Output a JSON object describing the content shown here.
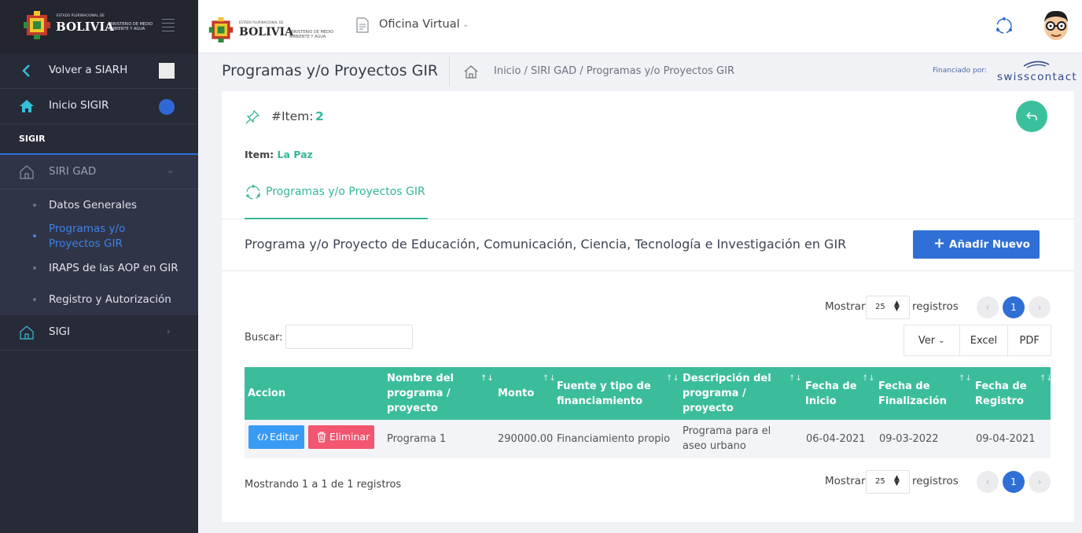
{
  "brand": {
    "emblem_small": "ESTADO PLURINACIONAL DE",
    "name": "BOLIVIA",
    "ministry": "MINISTERIO DE MEDIO AMBIENTE Y AGUA"
  },
  "sidebar": {
    "back": "Volver a SIARH",
    "home": "Inicio SIGIR",
    "section": "SIGIR",
    "group": "SIRI GAD",
    "items": [
      "Datos Generales",
      "Programas y/o Proyectos GIR",
      "IRAPS de las AOP en GIR",
      "Registro y Autorización"
    ],
    "other": "SIGI"
  },
  "topbar": {
    "office": "Oficina Virtual"
  },
  "header": {
    "title": "Programas y/o Proyectos GIR",
    "breadcrumb": "Inicio  /  SIRI GAD  /  Programas y/o Proyectos GIR",
    "funded_by": "Financiado por:",
    "sponsor": "swisscontact"
  },
  "card": {
    "item_label": "#Item:",
    "item_value": "2",
    "item2_label": "Item:",
    "item2_value": "La Paz",
    "tab": "Programas y/o Proyectos GIR",
    "section_title": "Programa y/o Proyecto de Educación, Comunicación, Ciencia, Tecnología e Investigación en GIR",
    "add_button": "Añadir Nuevo"
  },
  "table_controls": {
    "show": "Mostrar",
    "page_size": "25",
    "records": "registros",
    "search": "Buscar:",
    "view": "Ver",
    "excel": "Excel",
    "pdf": "PDF",
    "current_page": "1",
    "info": "Mostrando 1 a 1 de 1 registros"
  },
  "table": {
    "headers": [
      "Accion",
      "Nombre del programa / proyecto",
      "Monto",
      "Fuente y tipo de financiamiento",
      "Descripción del programa / proyecto",
      "Fecha de Inicio",
      "Fecha de Finalización",
      "Fecha de Registro"
    ],
    "rows": [
      {
        "edit": "Editar",
        "delete": "Eliminar",
        "name": "Programa 1",
        "amount": "290000.00",
        "source": "Financiamiento propio",
        "description": "Programa para el aseo urbano",
        "start": "06-04-2021",
        "end": "09-03-2022",
        "registered": "09-04-2021"
      }
    ]
  },
  "colors": {
    "accent": "#3bbd9c",
    "primary": "#2f6fd6",
    "danger": "#f25670",
    "info": "#3a9bf5",
    "sidebar": "#272a37"
  }
}
